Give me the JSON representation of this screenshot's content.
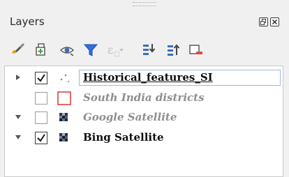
{
  "panel": {
    "title": "Layers",
    "buttons": [
      {
        "name": "float-panel",
        "icon": "float-icon"
      },
      {
        "name": "close-panel",
        "icon": "close-icon"
      }
    ]
  },
  "toolbar": {
    "tools": [
      {
        "name": "style-layer",
        "icon": "paintbrush-icon"
      },
      {
        "name": "add-group",
        "icon": "add-group-icon"
      },
      {
        "name": "manage-themes",
        "icon": "eye-icon"
      },
      {
        "name": "filter-legend",
        "icon": "filter-icon"
      },
      {
        "name": "filter-expression",
        "icon": "expression-icon",
        "disabled": true
      },
      {
        "name": "expand-all",
        "icon": "expand-all-icon"
      },
      {
        "name": "collapse-all",
        "icon": "collapse-all-icon"
      },
      {
        "name": "remove-layer",
        "icon": "remove-layer-icon"
      }
    ]
  },
  "layers": [
    {
      "name": "Historical_features_SI",
      "checked": true,
      "expander": "collapsed",
      "icon": "point-layer-icon",
      "visible": true,
      "current": true
    },
    {
      "name": "South India districts",
      "checked": false,
      "expander": "none",
      "icon": "polygon-layer-icon",
      "visible": false
    },
    {
      "name": "Google Satellite",
      "checked": false,
      "expander": "expanded",
      "icon": "raster-layer-icon",
      "visible": false
    },
    {
      "name": "Bing Satellite",
      "checked": true,
      "expander": "expanded",
      "icon": "raster-layer-icon",
      "visible": true
    }
  ],
  "colors": {
    "polygon_stroke": "#d03a35",
    "filter_blue": "#2f6fe0",
    "remove_red": "#e34b3f",
    "selection_border": "#9fb7d9"
  }
}
